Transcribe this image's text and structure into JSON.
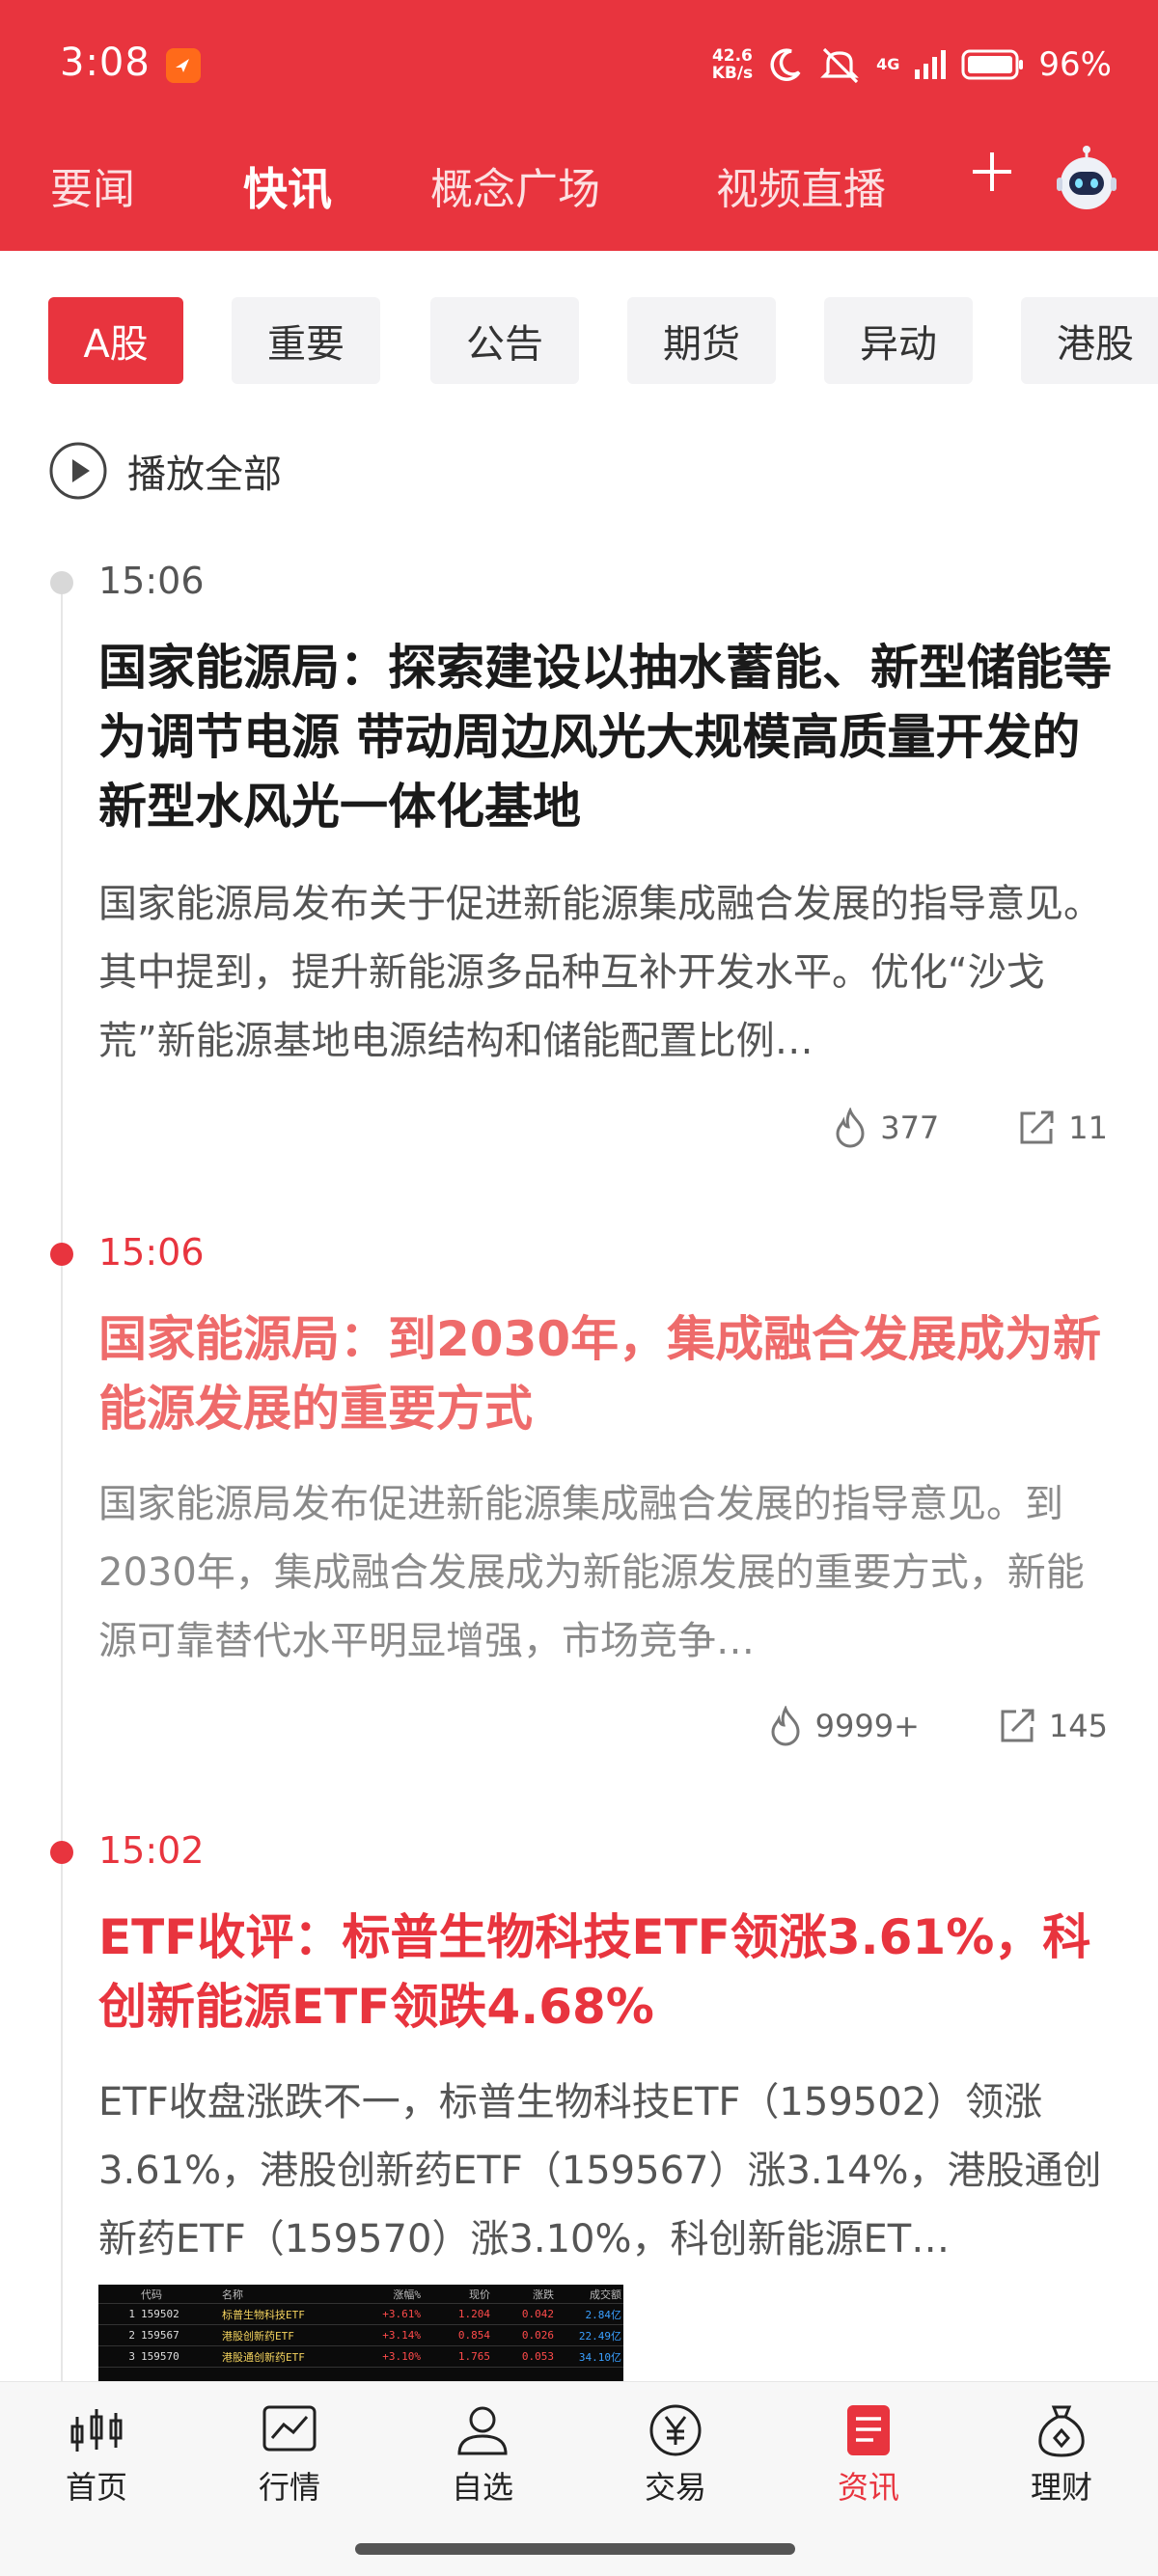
{
  "status_bar": {
    "time": "3:08",
    "net_speed_top": "42.6",
    "net_speed_bottom": "KB/s",
    "network": "4G",
    "battery": "96%"
  },
  "nav": {
    "tabs": [
      "要闻",
      "快讯",
      "概念广场",
      "视频直播"
    ],
    "active_tab": "快讯"
  },
  "filters": {
    "chips": [
      "A股",
      "重要",
      "公告",
      "期货",
      "异动",
      "港股"
    ],
    "active": "A股"
  },
  "play_all": "播放全部",
  "news": [
    {
      "time": "15:06",
      "title": "国家能源局：探索建设以抽水蓄能、新型储能等为调节电源 带动周边风光大规模高质量开发的新型水风光一体化基地",
      "summary": "国家能源局发布关于促进新能源集成融合发展的指导意见。其中提到，提升新能源多品种互补开发水平。优化“沙戈荒”新能源基地电源结构和储能配置比例…",
      "likes": "377",
      "shares": "11"
    },
    {
      "time": "15:06",
      "title": "国家能源局：到2030年，集成融合发展成为新能源发展的重要方式",
      "summary": "国家能源局发布促进新能源集成融合发展的指导意见。到2030年，集成融合发展成为新能源发展的重要方式，新能源可靠替代水平明显增强，市场竞争…",
      "likes": "9999+",
      "shares": "145"
    },
    {
      "time": "15:02",
      "title": "ETF收评：标普生物科技ETF领涨3.61%，科创新能源ETF领跌4.68%",
      "summary": "ETF收盘涨跌不一，标普生物科技ETF（159502）领涨3.61%，港股创新药ETF（159567）涨3.14%，港股通创新药ETF（159570）涨3.10%，科创新能源ET…"
    }
  ],
  "thumbnail_table": {
    "headers": [
      "代码",
      "名称",
      "涨幅%",
      "现价",
      "涨跌",
      "成交额"
    ],
    "rows": [
      [
        "1",
        "159502",
        "标普生物科技ETF",
        "+3.61%",
        "1.204",
        "0.042",
        "2.84亿"
      ],
      [
        "2",
        "159567",
        "港股创新药ETF",
        "+3.14%",
        "0.854",
        "0.026",
        "22.49亿"
      ],
      [
        "3",
        "159570",
        "港股通创新药ETF",
        "+3.10%",
        "1.765",
        "0.053",
        "34.10亿"
      ]
    ]
  },
  "bottom_nav": {
    "items": [
      "首页",
      "行情",
      "自选",
      "交易",
      "资讯",
      "理财"
    ],
    "active": "资讯"
  },
  "colors": {
    "brand_red": "#e8343e",
    "headline_pink": "#ee6b6b"
  }
}
